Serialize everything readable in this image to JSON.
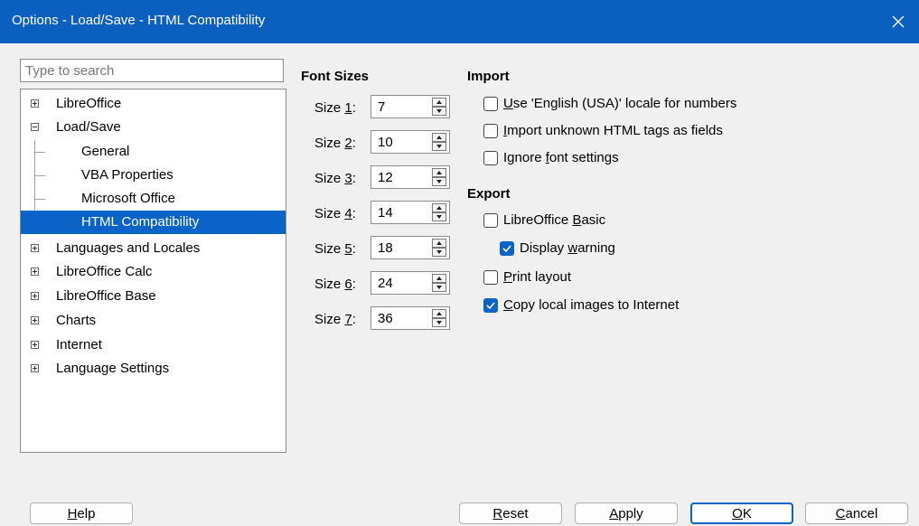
{
  "window": {
    "title": "Options - Load/Save - HTML Compatibility",
    "close_icon": "close-icon"
  },
  "search": {
    "placeholder": "Type to search",
    "value": ""
  },
  "tree": {
    "items": [
      {
        "label": "LibreOffice",
        "expander": "plus"
      },
      {
        "label": "Load/Save",
        "expander": "minus"
      },
      {
        "label": "General",
        "child": true
      },
      {
        "label": "VBA Properties",
        "child": true
      },
      {
        "label": "Microsoft Office",
        "child": true
      },
      {
        "label": "HTML Compatibility",
        "child": true,
        "selected": true
      },
      {
        "label": "Languages and Locales",
        "expander": "plus"
      },
      {
        "label": "LibreOffice Calc",
        "expander": "plus"
      },
      {
        "label": "LibreOffice Base",
        "expander": "plus"
      },
      {
        "label": "Charts",
        "expander": "plus"
      },
      {
        "label": "Internet",
        "expander": "plus"
      },
      {
        "label": "Language Settings",
        "expander": "plus"
      }
    ]
  },
  "font_sizes": {
    "heading": "Font Sizes",
    "rows": [
      {
        "prefix": "Size ",
        "mnemonic": "1",
        "suffix": ":",
        "value": "7"
      },
      {
        "prefix": "Size ",
        "mnemonic": "2",
        "suffix": ":",
        "value": "10"
      },
      {
        "prefix": "Size ",
        "mnemonic": "3",
        "suffix": ":",
        "value": "12"
      },
      {
        "prefix": "Size ",
        "mnemonic": "4",
        "suffix": ":",
        "value": "14"
      },
      {
        "prefix": "Size ",
        "mnemonic": "5",
        "suffix": ":",
        "value": "18"
      },
      {
        "prefix": "Size ",
        "mnemonic": "6",
        "suffix": ":",
        "value": "24"
      },
      {
        "prefix": "Size ",
        "mnemonic": "7",
        "suffix": ":",
        "value": "36"
      }
    ]
  },
  "import": {
    "heading": "Import",
    "english_locale": {
      "pre": "",
      "mnemonic": "U",
      "post": "se 'English (USA)' locale for numbers",
      "checked": false
    },
    "unknown_tags": {
      "pre": "",
      "mnemonic": "I",
      "post": "mport unknown HTML tags as fields",
      "checked": false
    },
    "ignore_font": {
      "pre": "Ignore ",
      "mnemonic": "f",
      "post": "ont settings",
      "checked": false
    }
  },
  "export": {
    "heading": "Export",
    "basic": {
      "pre": "LibreOffice ",
      "mnemonic": "B",
      "post": "asic",
      "checked": false
    },
    "display_warning": {
      "pre": "Display ",
      "mnemonic": "w",
      "post": "arning",
      "checked": true
    },
    "print_layout": {
      "pre": "",
      "mnemonic": "P",
      "post": "rint layout",
      "checked": false
    },
    "copy_images": {
      "pre": "",
      "mnemonic": "C",
      "post": "opy local images to Internet",
      "checked": true
    }
  },
  "buttons": {
    "help": {
      "pre": "",
      "mnemonic": "H",
      "post": "elp"
    },
    "reset": {
      "pre": "",
      "mnemonic": "R",
      "post": "eset"
    },
    "apply": {
      "pre": "",
      "mnemonic": "A",
      "post": "pply"
    },
    "ok": {
      "pre": "",
      "mnemonic": "O",
      "post": "K"
    },
    "cancel": {
      "pre": "",
      "mnemonic": "C",
      "post": "ancel"
    }
  },
  "colors": {
    "titlebar": "#0a5fbf",
    "selection": "#0a64c8",
    "checkbox_checked": "#0a64c8"
  }
}
